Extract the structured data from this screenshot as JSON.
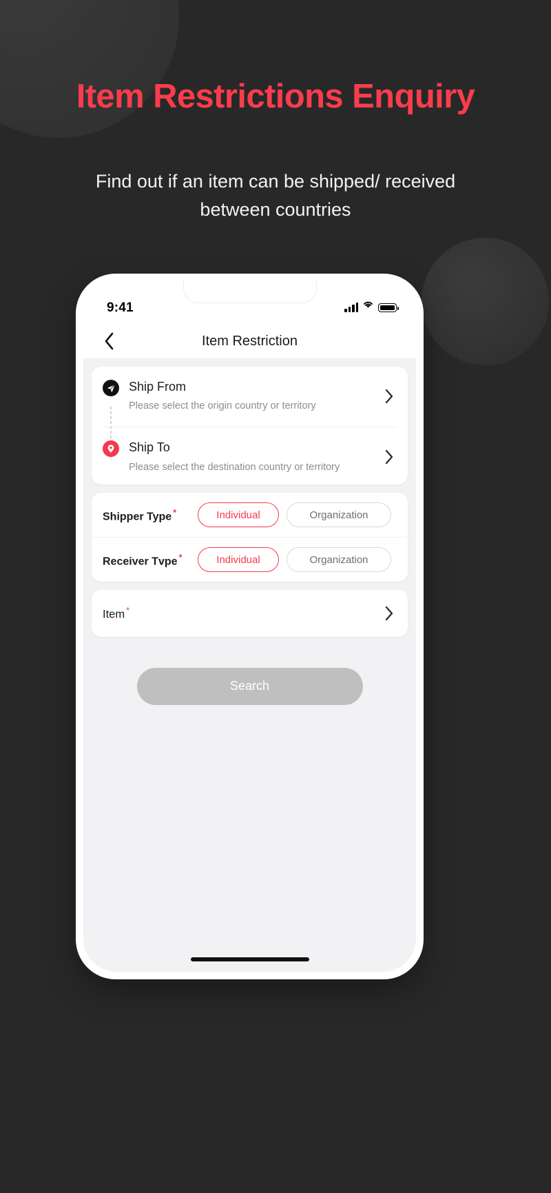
{
  "hero": {
    "title": "Item Restrictions Enquiry",
    "subtitle": "Find out if an item can be shipped/ received between countries",
    "title_color": "#fa3c4c",
    "background_color": "#282828"
  },
  "phone": {
    "statusbar": {
      "time": "9:41",
      "signal_icon": "cellular-bars-icon",
      "wifi_icon": "wifi-icon",
      "battery_icon": "battery-full-icon"
    },
    "navbar": {
      "back_icon": "chevron-left-icon",
      "title": "Item Restriction"
    },
    "ship_card": {
      "rows": [
        {
          "icon": "send-origin-icon",
          "label": "Ship From",
          "placeholder": "Please select the origin country or territory",
          "chevron_icon": "chevron-right-icon"
        },
        {
          "icon": "destination-pin-icon",
          "label": "Ship To",
          "placeholder": "Please select the destination country or territory",
          "chevron_icon": "chevron-right-icon"
        }
      ]
    },
    "type_card": {
      "rows": [
        {
          "label": "Shipper Type",
          "required_mark": "*",
          "option_selected": "Individual",
          "option_unselected": "Organization"
        },
        {
          "label": "Receiver Tvpe",
          "required_mark": "*",
          "option_selected": "Individual",
          "option_unselected": "Organization"
        }
      ]
    },
    "item_card": {
      "label": "Item",
      "required_mark": "*",
      "chevron_icon": "chevron-right-icon"
    },
    "search_button": {
      "label": "Search",
      "enabled": false,
      "color": "#bfbfbf"
    }
  },
  "colors": {
    "accent_red": "#f5394b",
    "screen_bg": "#f2f2f4",
    "card_bg": "#ffffff"
  }
}
